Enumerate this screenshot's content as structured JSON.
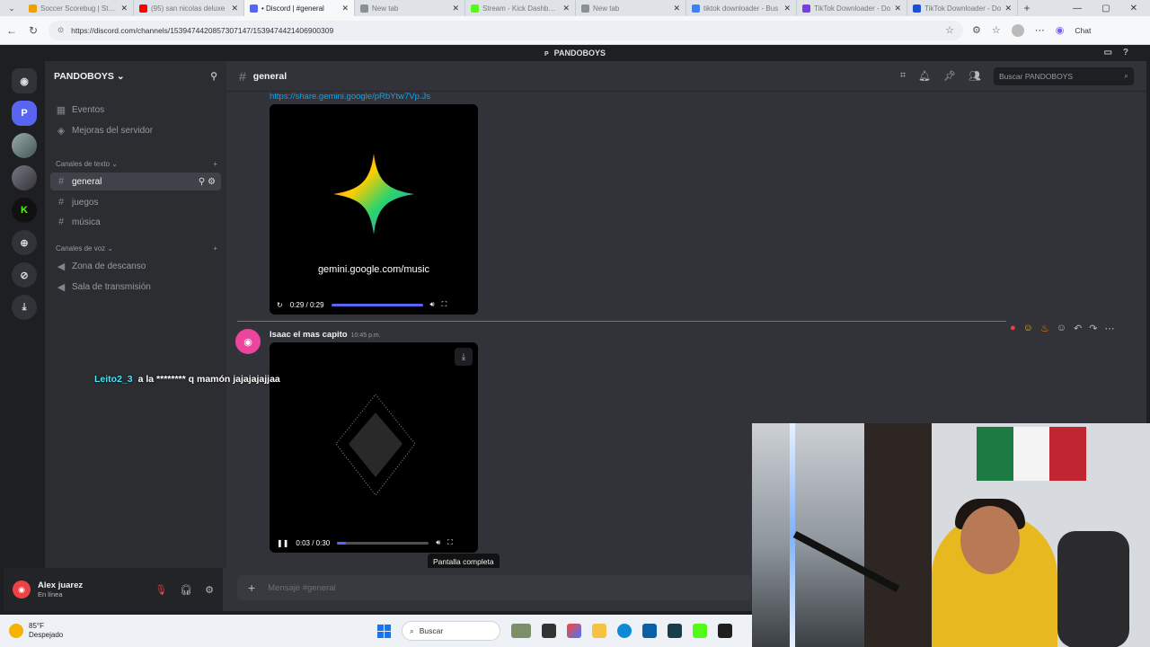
{
  "browser": {
    "tabs": [
      {
        "title": "Soccer Scorebug | Stand",
        "color": "#f0a000",
        "active": false
      },
      {
        "title": "(95) san nicolas deluxe",
        "color": "#ff0000",
        "active": false
      },
      {
        "title": "• Discord | #general",
        "color": "#5865f2",
        "active": true
      },
      {
        "title": "New tab",
        "color": "#8a8f98",
        "active": false
      },
      {
        "title": "Stream - Kick Dashboard",
        "color": "#53fc18",
        "active": false
      },
      {
        "title": "New tab",
        "color": "#8a8f98",
        "active": false
      },
      {
        "title": "tiktok downloader - Bus",
        "color": "#3b82f6",
        "active": false
      },
      {
        "title": "TikTok Downloader - Do",
        "color": "#7c3aed",
        "active": false
      },
      {
        "title": "TikTok Downloader - Do",
        "color": "#1d4ed8",
        "active": false
      }
    ],
    "new_tab_glyph": "+",
    "url": "https://discord.com/channels/1539474420857307147/1539474421406900309",
    "chat_label": "Chat"
  },
  "discord": {
    "window_title": "PANDOBOYS",
    "server_name": "PANDOBOYS",
    "server_initial": "P",
    "sidebar": {
      "top_items": [
        {
          "label": "Eventos",
          "icon": "calendar-icon"
        },
        {
          "label": "Mejoras del servidor",
          "icon": "boost-icon"
        }
      ],
      "text_category": "Canales de texto",
      "text_channels": [
        {
          "label": "general",
          "selected": true
        },
        {
          "label": "juegos",
          "selected": false
        },
        {
          "label": "música",
          "selected": false
        }
      ],
      "voice_category": "Canales de voz",
      "voice_channels": [
        {
          "label": "Zona de descanso"
        },
        {
          "label": "Sala de transmisión"
        }
      ]
    },
    "user": {
      "name": "Alex juarez",
      "status": "En línea"
    },
    "channel_header": {
      "name": "general",
      "search_placeholder": "Buscar PANDOBOYS"
    },
    "messages": {
      "link": "https://share.gemini.google/pRbYtw7Vp.Js",
      "video1": {
        "caption": "gemini.google.com/music",
        "time": "0:29 / 0:29",
        "progress": 1.0
      },
      "author": "Isaac el mas capito",
      "timestamp": "10:45 p.m.",
      "video2": {
        "time": "0:03 / 0:30",
        "progress": 0.1
      },
      "tooltip": "Pantalla completa"
    },
    "composer_placeholder": "Mensaje #general"
  },
  "overlay_chat": {
    "user": "Leito2_3",
    "text": "a la ******** q mamón jajajajajjaa"
  },
  "taskbar": {
    "temp": "85°F",
    "weather": "Despejado",
    "search": "Buscar"
  }
}
